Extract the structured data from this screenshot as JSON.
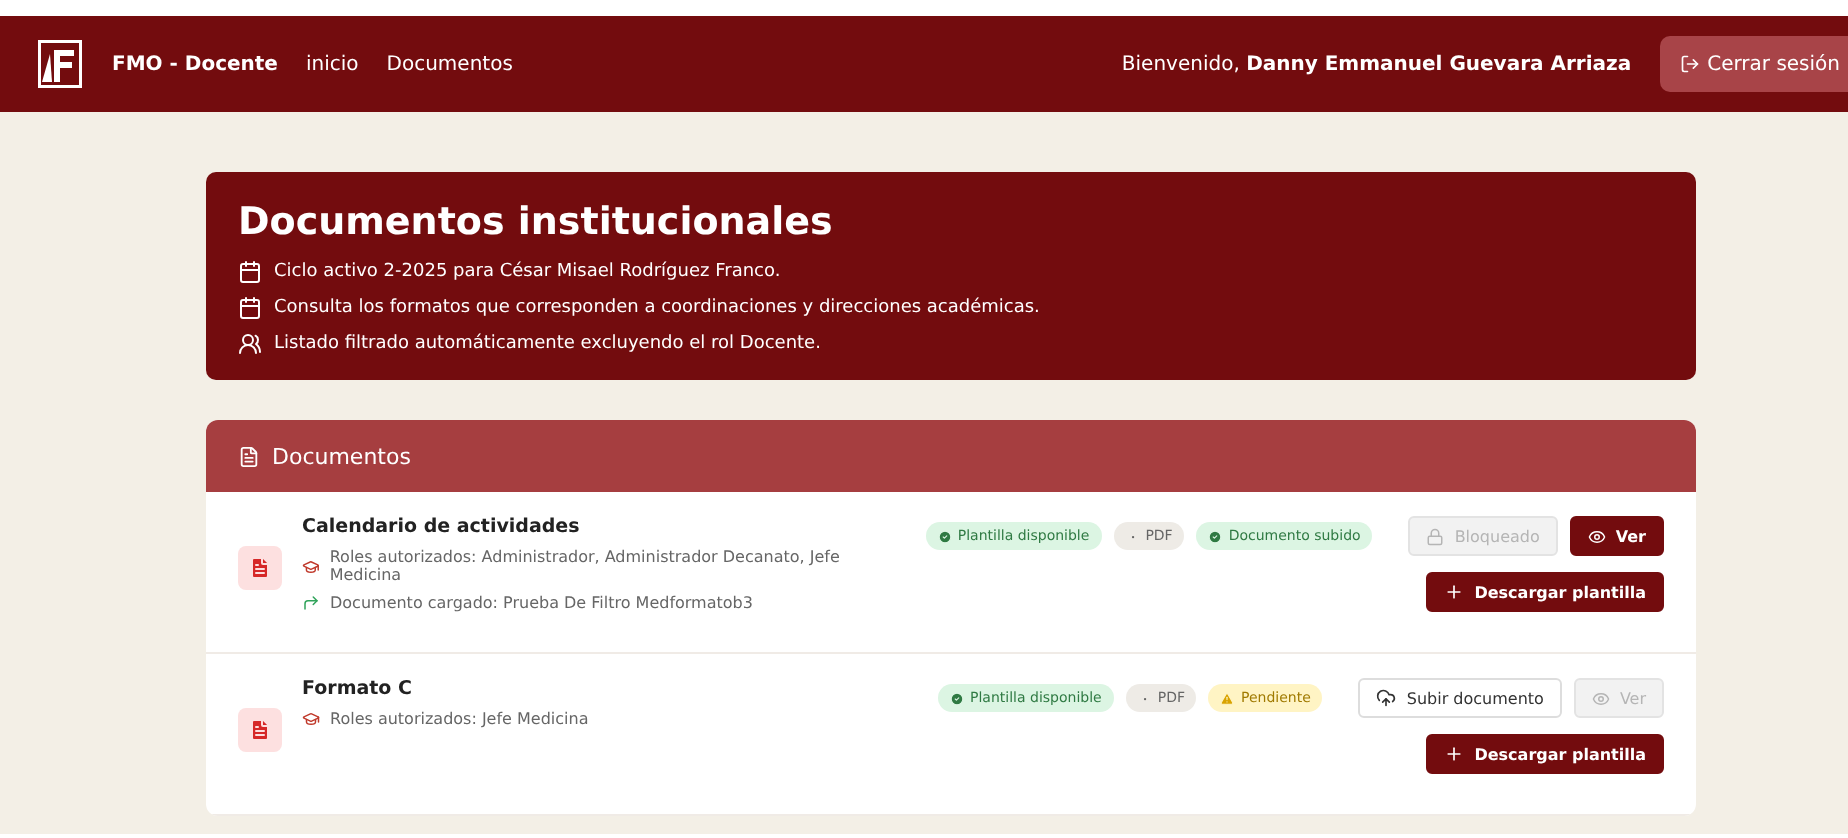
{
  "navbar": {
    "brand": "FMO - Docente",
    "links": [
      "inicio",
      "Documentos"
    ],
    "welcome": "Bienvenido, **Danny Emmanuel Guevara Arriaza**",
    "logout": "Cerrar sesión"
  },
  "hero": {
    "title": "Documentos institucionales",
    "lines": [
      {
        "kind": "calendar",
        "text": "Ciclo activo 2-2025 para César Misael Rodríguez Franco."
      },
      {
        "kind": "calendar",
        "text": "Consulta los formatos que corresponden a coordinaciones y direcciones académicas."
      },
      {
        "kind": "users",
        "text": "Listado filtrado automáticamente excluyendo el rol Docente."
      }
    ]
  },
  "documents": {
    "title": "Documentos",
    "items": [
      {
        "name": "Calendario de actividades",
        "roles": "Roles autorizados: Administrador, Administrador Decanato, Jefe Medicina",
        "uploaded": "Documento cargado: Prueba De Filtro Medformatob3",
        "badges": [
          {
            "kind": "success",
            "text": "Plantilla disponible"
          },
          {
            "kind": "neutral",
            "text": "PDF"
          },
          {
            "kind": "success",
            "text": "Documento subido"
          }
        ],
        "actions": [
          {
            "kind": "lock",
            "text": "Bloqueado",
            "disabled": true
          },
          {
            "kind": "view",
            "text": "Ver",
            "disabled": false
          }
        ],
        "download": "Descargar plantilla"
      },
      {
        "name": "Formato C",
        "roles": "Roles autorizados: Jefe Medicina",
        "badges": [
          {
            "kind": "success",
            "text": "Plantilla disponible"
          },
          {
            "kind": "neutral",
            "text": "PDF"
          },
          {
            "kind": "warning",
            "text": "Pendiente"
          }
        ],
        "actions": [
          {
            "kind": "upload",
            "text": "Subir documento",
            "disabled": false
          },
          {
            "kind": "view",
            "text": "Ver",
            "disabled": true
          }
        ],
        "download": "Descargar plantilla"
      }
    ]
  }
}
